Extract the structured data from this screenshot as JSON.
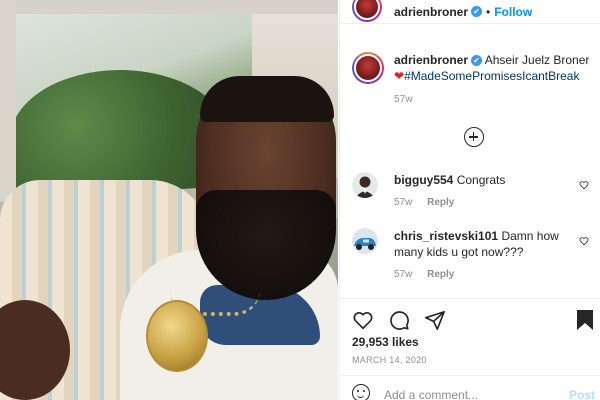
{
  "post_header": {
    "username": "adrienbroner",
    "verified_badge": "✔",
    "separator": "•",
    "follow_label": "Follow"
  },
  "caption": {
    "username": "adrienbroner",
    "verified_badge": "✔",
    "text": "Ahseir Juelz Broner",
    "heart": "❤",
    "hashtag": "#MadeSomePromisesIcantBreak",
    "time": "57w"
  },
  "comments": [
    {
      "username": "bigguy554",
      "text": "Congrats",
      "time": "57w",
      "reply_label": "Reply"
    },
    {
      "username": "chris_ristevski101",
      "text": "Damn how many kids u got now???",
      "time": "57w",
      "reply_label": "Reply"
    }
  ],
  "actions": {
    "likes": "29,953 likes",
    "date": "MARCH 14, 2020"
  },
  "add_comment": {
    "placeholder": "Add a comment...",
    "post_label": "Post"
  },
  "colors": {
    "accent": "#0095f6",
    "verified": "#3897f0",
    "heart": "#ed1c24",
    "hashtag": "#00376b",
    "muted": "#8e8e8e"
  },
  "icons": [
    "verified-badge-icon",
    "load-more-comments-icon",
    "heart-icon",
    "comment-icon",
    "share-icon",
    "bookmark-icon",
    "emoji-icon",
    "comment-like-icon"
  ]
}
